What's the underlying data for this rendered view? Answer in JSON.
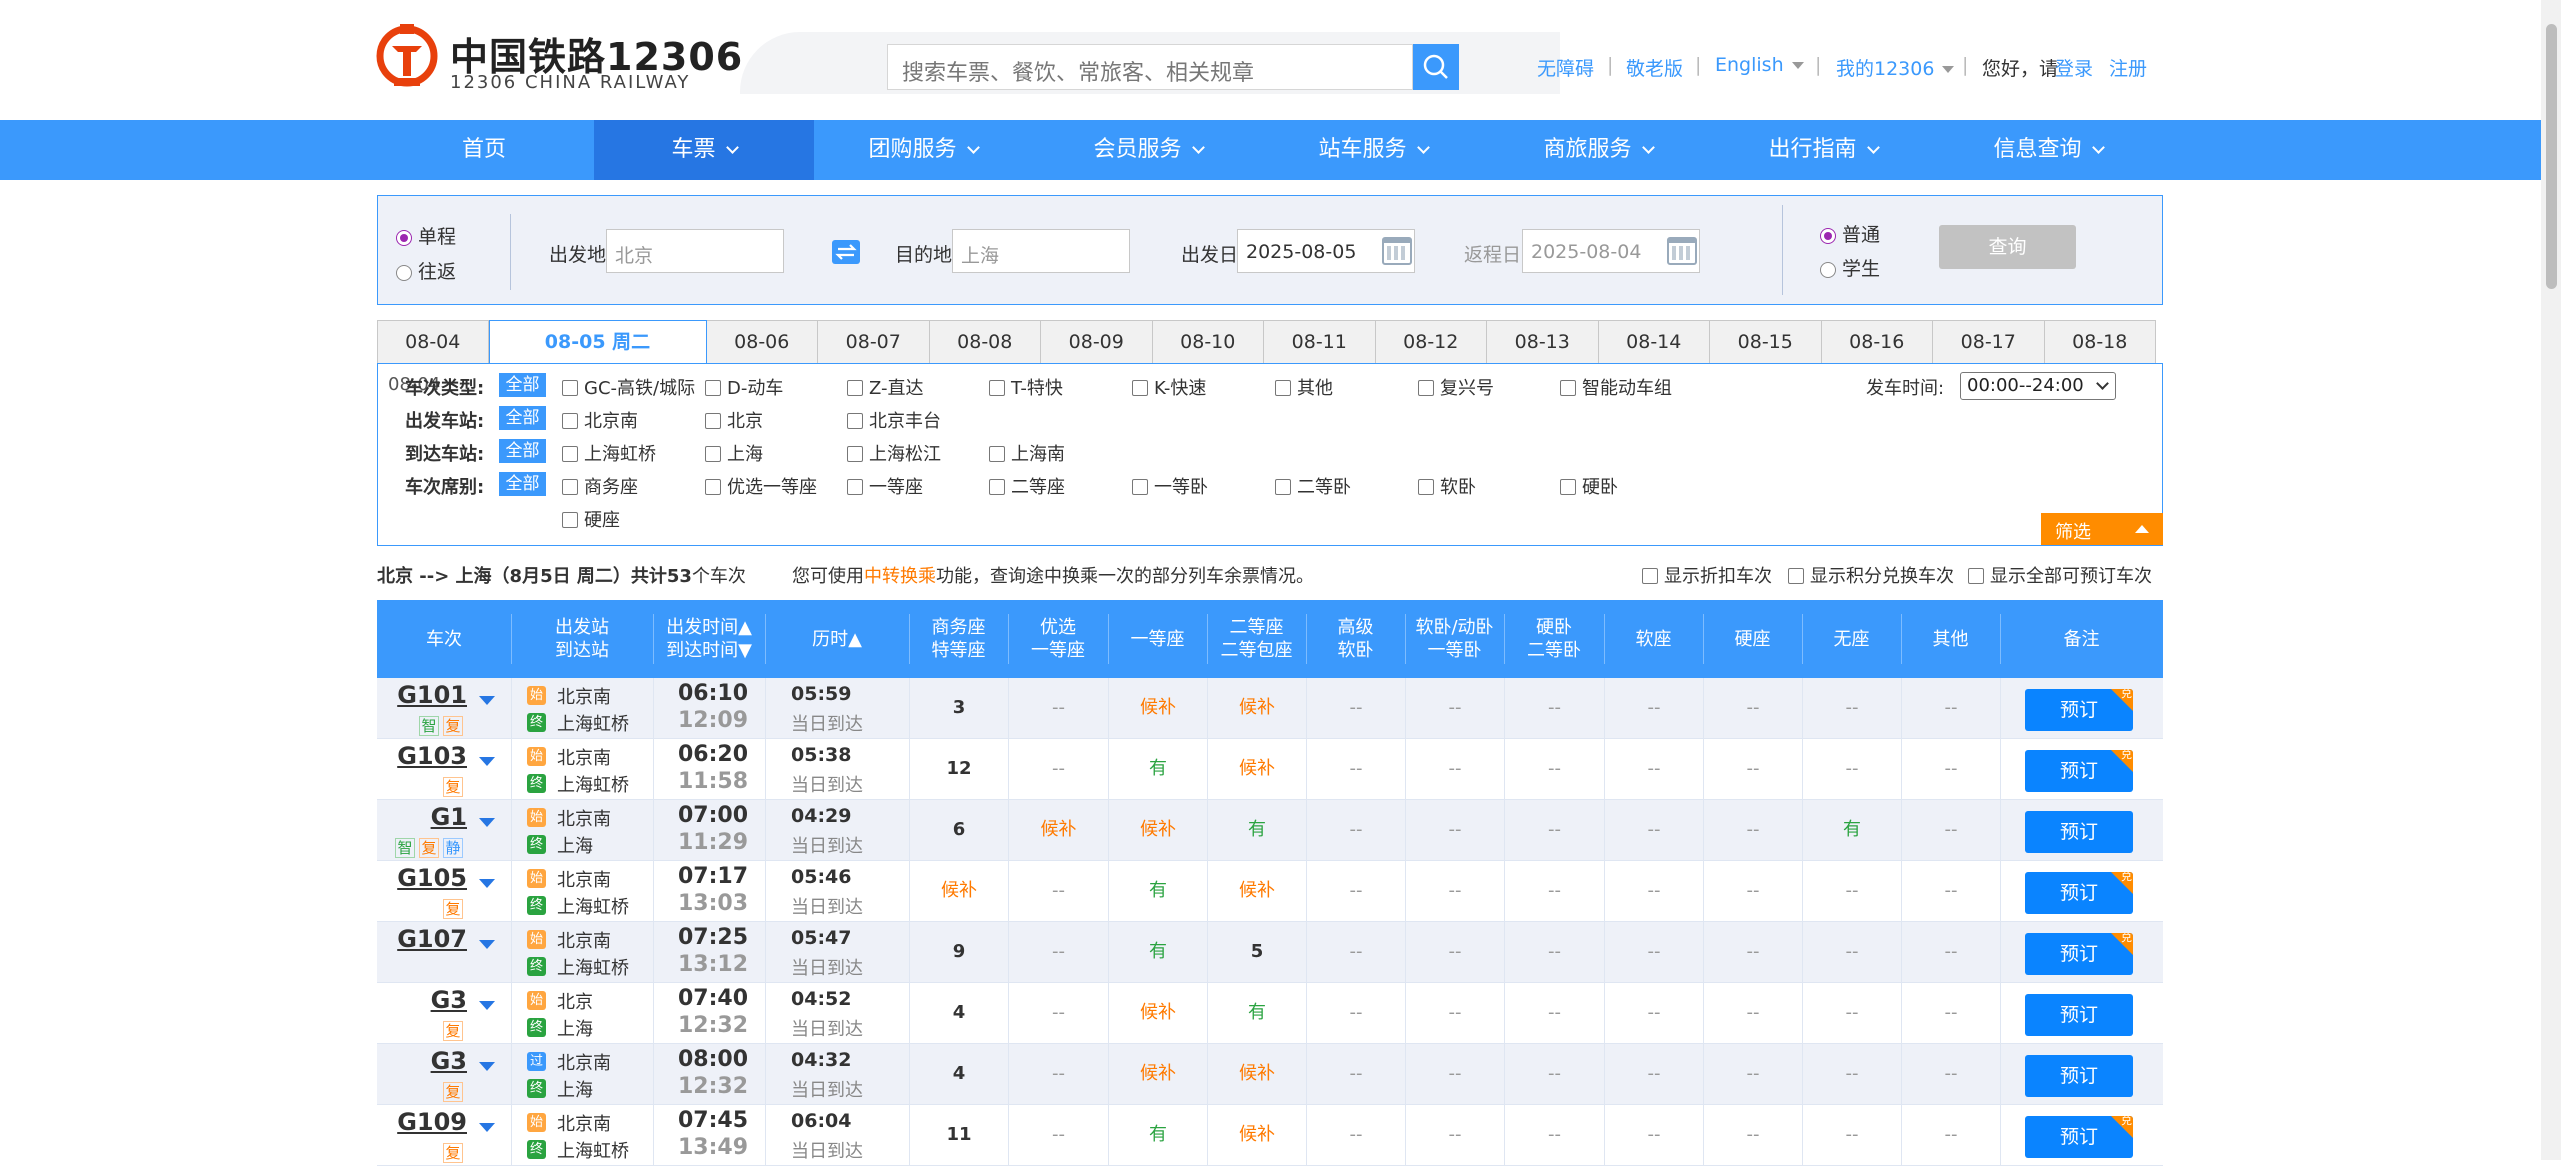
{
  "header": {
    "logo_cn": "中国铁路12306",
    "logo_en": "12306 CHINA RAILWAY",
    "search_placeholder": "搜索车票、餐饮、常旅客、相关规章",
    "links": {
      "accessibility": "无障碍",
      "elder": "敬老版",
      "english": "English",
      "my12306": "我的12306",
      "greeting": "您好，请",
      "login": "登录",
      "register": "注册"
    }
  },
  "nav": [
    {
      "label": "首页",
      "caret": false
    },
    {
      "label": "车票",
      "caret": true
    },
    {
      "label": "团购服务",
      "caret": true
    },
    {
      "label": "会员服务",
      "caret": true
    },
    {
      "label": "站车服务",
      "caret": true
    },
    {
      "label": "商旅服务",
      "caret": true
    },
    {
      "label": "出行指南",
      "caret": true
    },
    {
      "label": "信息查询",
      "caret": true
    }
  ],
  "query": {
    "trip_oneway": "单程",
    "trip_round": "往返",
    "from_label": "出发地",
    "from_value": "北京",
    "to_label": "目的地",
    "to_value": "上海",
    "depart_label": "出发日",
    "depart_value": "2025-08-05",
    "return_label": "返程日",
    "return_value": "2025-08-04",
    "ticket_normal": "普通",
    "ticket_student": "学生",
    "query_button": "查询"
  },
  "date_tabs": [
    "08-04",
    "08-05 周二",
    "08-06",
    "08-07",
    "08-08",
    "08-09",
    "08-10",
    "08-11",
    "08-12",
    "08-13",
    "08-14",
    "08-15",
    "08-16",
    "08-17",
    "08-18"
  ],
  "filter": {
    "all": "全部",
    "train_type_label": "车次类型:",
    "train_type_overlap": "08-04",
    "train_types": [
      "GC-高铁/城际",
      "D-动车",
      "Z-直达",
      "T-特快",
      "K-快速",
      "其他",
      "复兴号",
      "智能动车组"
    ],
    "depart_station_label": "出发车站:",
    "depart_stations": [
      "北京南",
      "北京",
      "北京丰台"
    ],
    "arrive_station_label": "到达车站:",
    "arrive_stations": [
      "上海虹桥",
      "上海",
      "上海松江",
      "上海南"
    ],
    "seat_label": "车次席别:",
    "seats": [
      "商务座",
      "优选一等座",
      "一等座",
      "二等座",
      "一等卧",
      "二等卧",
      "软卧",
      "硬卧",
      "硬座"
    ],
    "time_label": "发车时间:",
    "time_value": "00:00--24:00",
    "filter_button": "筛选"
  },
  "summary": {
    "route": "北京 --> 上海（8月5日  周二）共计",
    "count": "53",
    "unit": "个车次",
    "tip_pre": "您可使用",
    "tip_link": "中转换乘",
    "tip_post": "功能，查询途中换乘一次的部分列车余票情况。",
    "opt1": "显示折扣车次",
    "opt2": "显示积分兑换车次",
    "opt3": "显示全部可预订车次"
  },
  "columns": [
    {
      "l1": "车次",
      "l2": ""
    },
    {
      "l1": "出发站",
      "l2": "到达站"
    },
    {
      "l1": "出发时间▲",
      "l2": "到达时间▼"
    },
    {
      "l1": "历时▲",
      "l2": ""
    },
    {
      "l1": "商务座",
      "l2": "特等座"
    },
    {
      "l1": "优选",
      "l2": "一等座"
    },
    {
      "l1": "一等座",
      "l2": ""
    },
    {
      "l1": "二等座",
      "l2": "二等包座"
    },
    {
      "l1": "高级",
      "l2": "软卧"
    },
    {
      "l1": "软卧/动卧",
      "l2": "一等卧"
    },
    {
      "l1": "硬卧",
      "l2": "二等卧"
    },
    {
      "l1": "软座",
      "l2": ""
    },
    {
      "l1": "硬座",
      "l2": ""
    },
    {
      "l1": "无座",
      "l2": ""
    },
    {
      "l1": "其他",
      "l2": ""
    },
    {
      "l1": "备注",
      "l2": ""
    }
  ],
  "station_tags": {
    "start": "始",
    "end": "终",
    "pass": "过"
  },
  "book_label": "预订",
  "book_corner": "兑",
  "trains": [
    {
      "no": "G101",
      "tags": [
        [
          "智",
          "g"
        ],
        [
          "复",
          "o"
        ]
      ],
      "from": "北京南",
      "from_tag": "start",
      "to": "上海虹桥",
      "dep": "06:10",
      "arr": "12:09",
      "dur": "05:59",
      "day": "当日到达",
      "seats": [
        "3",
        "--",
        "候补",
        "候补",
        "--",
        "--",
        "--",
        "--",
        "--",
        "--",
        "--"
      ],
      "corner": true
    },
    {
      "no": "G103",
      "tags": [
        [
          "复",
          "o"
        ]
      ],
      "from": "北京南",
      "from_tag": "start",
      "to": "上海虹桥",
      "dep": "06:20",
      "arr": "11:58",
      "dur": "05:38",
      "day": "当日到达",
      "seats": [
        "12",
        "--",
        "有",
        "候补",
        "--",
        "--",
        "--",
        "--",
        "--",
        "--",
        "--"
      ],
      "corner": true
    },
    {
      "no": "G1",
      "tags": [
        [
          "智",
          "g"
        ],
        [
          "复",
          "o"
        ],
        [
          "静",
          "b"
        ]
      ],
      "from": "北京南",
      "from_tag": "start",
      "to": "上海",
      "dep": "07:00",
      "arr": "11:29",
      "dur": "04:29",
      "day": "当日到达",
      "seats": [
        "6",
        "候补",
        "候补",
        "有",
        "--",
        "--",
        "--",
        "--",
        "--",
        "有",
        "--"
      ],
      "corner": false
    },
    {
      "no": "G105",
      "tags": [
        [
          "复",
          "o"
        ]
      ],
      "from": "北京南",
      "from_tag": "start",
      "to": "上海虹桥",
      "dep": "07:17",
      "arr": "13:03",
      "dur": "05:46",
      "day": "当日到达",
      "seats": [
        "候补",
        "--",
        "有",
        "候补",
        "--",
        "--",
        "--",
        "--",
        "--",
        "--",
        "--"
      ],
      "corner": true
    },
    {
      "no": "G107",
      "tags": [],
      "from": "北京南",
      "from_tag": "start",
      "to": "上海虹桥",
      "dep": "07:25",
      "arr": "13:12",
      "dur": "05:47",
      "day": "当日到达",
      "seats": [
        "9",
        "--",
        "有",
        "5",
        "--",
        "--",
        "--",
        "--",
        "--",
        "--",
        "--"
      ],
      "corner": true
    },
    {
      "no": "G3",
      "tags": [
        [
          "复",
          "o"
        ]
      ],
      "from": "北京",
      "from_tag": "start",
      "to": "上海",
      "dep": "07:40",
      "arr": "12:32",
      "dur": "04:52",
      "day": "当日到达",
      "seats": [
        "4",
        "--",
        "候补",
        "有",
        "--",
        "--",
        "--",
        "--",
        "--",
        "--",
        "--"
      ],
      "corner": false
    },
    {
      "no": "G3",
      "tags": [
        [
          "复",
          "o"
        ]
      ],
      "from": "北京南",
      "from_tag": "pass",
      "to": "上海",
      "dep": "08:00",
      "arr": "12:32",
      "dur": "04:32",
      "day": "当日到达",
      "seats": [
        "4",
        "--",
        "候补",
        "候补",
        "--",
        "--",
        "--",
        "--",
        "--",
        "--",
        "--"
      ],
      "corner": false
    },
    {
      "no": "G109",
      "tags": [
        [
          "复",
          "o"
        ]
      ],
      "from": "北京南",
      "from_tag": "start",
      "to": "上海虹桥",
      "dep": "07:45",
      "arr": "13:49",
      "dur": "06:04",
      "day": "当日到达",
      "seats": [
        "11",
        "--",
        "有",
        "候补",
        "--",
        "--",
        "--",
        "--",
        "--",
        "--",
        "--"
      ],
      "corner": true
    }
  ]
}
